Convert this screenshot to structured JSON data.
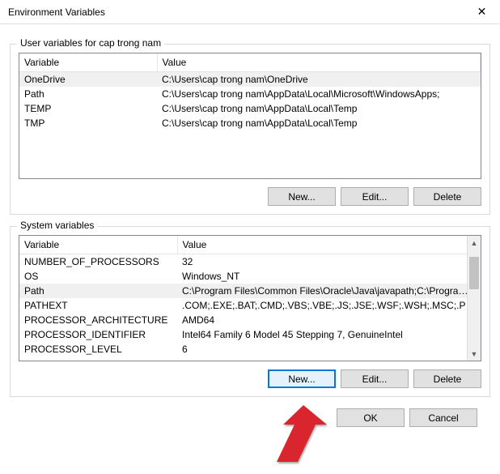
{
  "window": {
    "title": "Environment Variables"
  },
  "user_section": {
    "label": "User variables for cap trong nam",
    "columns": {
      "variable": "Variable",
      "value": "Value"
    },
    "rows": [
      {
        "variable": "OneDrive",
        "value": "C:\\Users\\cap trong nam\\OneDrive",
        "selected": true
      },
      {
        "variable": "Path",
        "value": "C:\\Users\\cap trong nam\\AppData\\Local\\Microsoft\\WindowsApps;",
        "selected": false
      },
      {
        "variable": "TEMP",
        "value": "C:\\Users\\cap trong nam\\AppData\\Local\\Temp",
        "selected": false
      },
      {
        "variable": "TMP",
        "value": "C:\\Users\\cap trong nam\\AppData\\Local\\Temp",
        "selected": false
      }
    ],
    "buttons": {
      "new": "New...",
      "edit": "Edit...",
      "delete": "Delete"
    }
  },
  "system_section": {
    "label": "System variables",
    "columns": {
      "variable": "Variable",
      "value": "Value"
    },
    "rows": [
      {
        "variable": "NUMBER_OF_PROCESSORS",
        "value": "32",
        "selected": false
      },
      {
        "variable": "OS",
        "value": "Windows_NT",
        "selected": false
      },
      {
        "variable": "Path",
        "value": "C:\\Program Files\\Common Files\\Oracle\\Java\\javapath;C:\\Program ...",
        "selected": true
      },
      {
        "variable": "PATHEXT",
        "value": ".COM;.EXE;.BAT;.CMD;.VBS;.VBE;.JS;.JSE;.WSF;.WSH;.MSC;.PY;.PYW",
        "selected": false
      },
      {
        "variable": "PROCESSOR_ARCHITECTURE",
        "value": "AMD64",
        "selected": false
      },
      {
        "variable": "PROCESSOR_IDENTIFIER",
        "value": "Intel64 Family 6 Model 45 Stepping 7, GenuineIntel",
        "selected": false
      },
      {
        "variable": "PROCESSOR_LEVEL",
        "value": "6",
        "selected": false
      }
    ],
    "buttons": {
      "new": "New...",
      "edit": "Edit...",
      "delete": "Delete"
    }
  },
  "footer": {
    "ok": "OK",
    "cancel": "Cancel"
  }
}
